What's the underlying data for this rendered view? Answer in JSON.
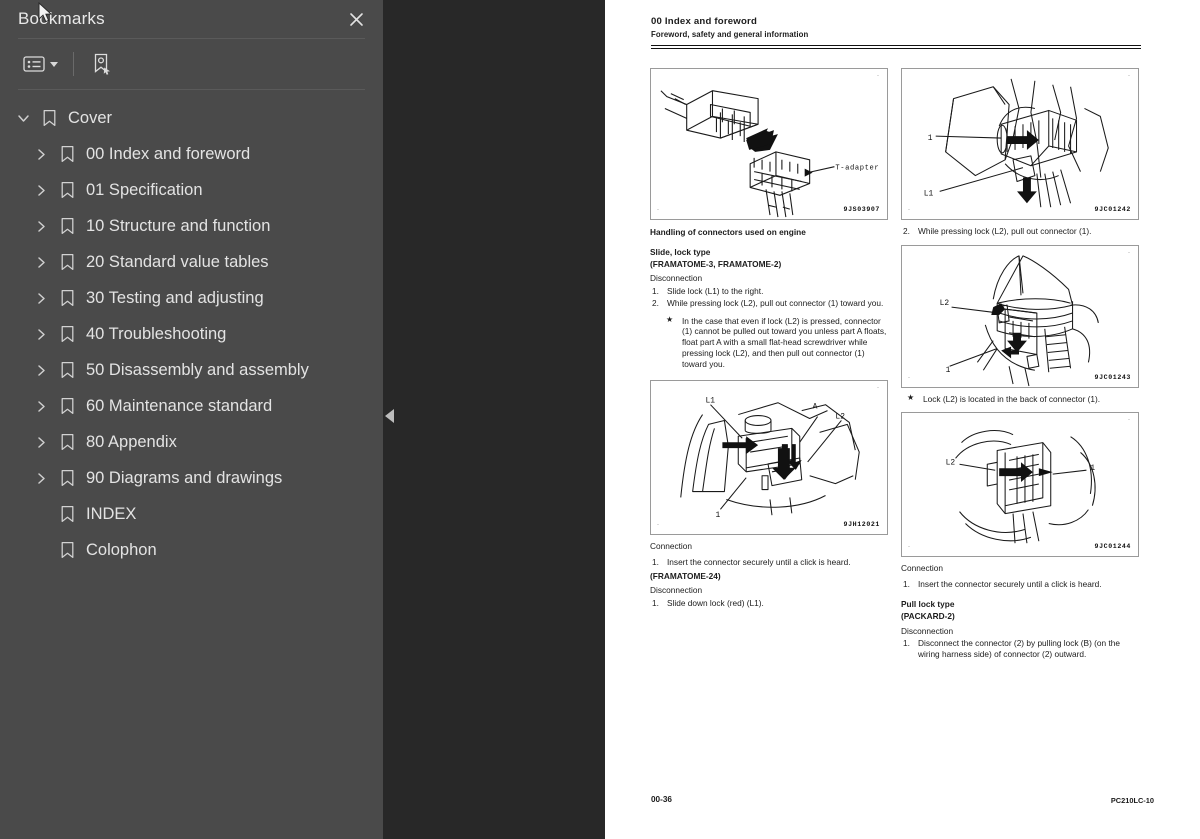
{
  "sidebar": {
    "title": "Bookmarks",
    "close_icon": "close-icon",
    "toolbar": {
      "list_options_icon": "list-options-icon",
      "add_bookmark_icon": "add-bookmark-icon"
    },
    "items": [
      {
        "label": "Cover",
        "level": 0,
        "expandable": true,
        "expanded": true
      },
      {
        "label": "00 Index and foreword",
        "level": 1,
        "expandable": true,
        "expanded": false
      },
      {
        "label": "01 Specification",
        "level": 1,
        "expandable": true,
        "expanded": false
      },
      {
        "label": "10 Structure and function",
        "level": 1,
        "expandable": true,
        "expanded": false
      },
      {
        "label": "20 Standard value tables",
        "level": 1,
        "expandable": true,
        "expanded": false
      },
      {
        "label": "30 Testing and adjusting",
        "level": 1,
        "expandable": true,
        "expanded": false
      },
      {
        "label": "40 Troubleshooting",
        "level": 1,
        "expandable": true,
        "expanded": false
      },
      {
        "label": "50 Disassembly and assembly",
        "level": 1,
        "expandable": true,
        "expanded": false
      },
      {
        "label": "60 Maintenance standard",
        "level": 1,
        "expandable": true,
        "expanded": false
      },
      {
        "label": "80 Appendix",
        "level": 1,
        "expandable": true,
        "expanded": false
      },
      {
        "label": "90 Diagrams and drawings",
        "level": 1,
        "expandable": true,
        "expanded": false
      },
      {
        "label": "INDEX",
        "level": 1,
        "expandable": false,
        "expanded": false
      },
      {
        "label": "Colophon",
        "level": 1,
        "expandable": false,
        "expanded": false
      }
    ],
    "collapse_handle_icon": "collapse-panel-arrow-icon"
  },
  "page": {
    "header": {
      "title": "00 Index and foreword",
      "subtitle": "Foreword, safety and general information"
    },
    "figures": {
      "fig1": {
        "code": "9JS03907",
        "labels": [
          "T-adapter"
        ]
      },
      "fig2": {
        "code": "9JC01242",
        "labels": [
          "1",
          "L1"
        ]
      },
      "fig3": {
        "code": "9JC01243",
        "labels": [
          "L2",
          "1"
        ]
      },
      "fig4": {
        "code": "9JH12021",
        "labels": [
          "L1",
          "A",
          "L2",
          "1"
        ]
      },
      "fig5": {
        "code": "9JC01244",
        "labels": [
          "L2",
          "1"
        ]
      }
    },
    "left_column": {
      "section_heading": "Handling of connectors used on engine",
      "type_heading_1": "Slide, lock type",
      "type_heading_2": "(FRAMATOME-3, FRAMATOME-2)",
      "disconnection_label": "Disconnection",
      "disconnection_steps": [
        {
          "num": "1.",
          "text": "Slide lock (L1) to the right."
        },
        {
          "num": "2.",
          "text": "While pressing lock (L2), pull out connector (1) toward you."
        }
      ],
      "note_star": "★",
      "note_text": "In the case that even if lock (L2) is pressed, connector (1) cannot be pulled out toward you unless part A floats, float part A with a small flat-head screwdriver while pressing lock (L2), and then pull out connector (1) toward you.",
      "connection_label": "Connection",
      "connection_steps": [
        {
          "num": "1.",
          "text": "Insert the connector securely until a click is heard."
        }
      ],
      "type_heading_3": "(FRAMATOME-24)",
      "disconnection_label_2": "Disconnection",
      "disconnection_steps_2": [
        {
          "num": "1.",
          "text": "Slide down lock (red) (L1)."
        }
      ]
    },
    "right_column": {
      "caption_fig2": {
        "num": "2.",
        "text": "While pressing lock (L2), pull out connector (1)."
      },
      "note_star": "★",
      "note_text": "Lock (L2) is located in the back of connector (1).",
      "connection_label": "Connection",
      "connection_steps": [
        {
          "num": "1.",
          "text": "Insert the connector securely until a click is heard."
        }
      ],
      "type_heading_1": "Pull lock type",
      "type_heading_2": "(PACKARD-2)",
      "disconnection_label": "Disconnection",
      "disconnection_steps": [
        {
          "num": "1.",
          "text": "Disconnect the connector (2) by pulling lock (B) (on the wiring harness side) of connector (2) outward."
        }
      ]
    },
    "footer": {
      "page_number": "00-36",
      "model": "PC210LC-10"
    }
  },
  "colors": {
    "sidebar_bg": "#4a4a4a",
    "viewer_bg": "#282828",
    "page_bg": "#ffffff",
    "text": "#e3e3e3"
  }
}
